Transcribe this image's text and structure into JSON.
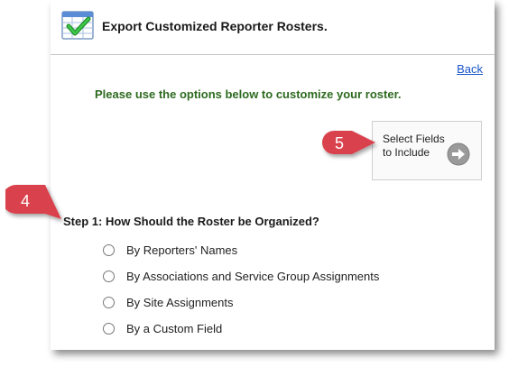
{
  "header": {
    "title": "Export Customized Reporter Rosters.",
    "icon": "checklist-icon"
  },
  "back_link": "Back",
  "instructions": "Please use the options below to customize your roster.",
  "select_fields_button": {
    "label": "Select Fields to Include",
    "icon": "arrow-right-circle-icon"
  },
  "step1": {
    "heading": "Step 1: How Should the Roster be Organized?",
    "options": [
      {
        "label": "By Reporters' Names",
        "selected": false
      },
      {
        "label": "By Associations and Service Group Assignments",
        "selected": false
      },
      {
        "label": "By Site Assignments",
        "selected": false
      },
      {
        "label": "By a Custom Field",
        "selected": false
      }
    ]
  },
  "callouts": [
    {
      "number": "5"
    },
    {
      "number": "4"
    }
  ],
  "colors": {
    "instruction_green": "#2d6a1f",
    "link_blue": "#1a55c7",
    "callout_red": "#d9424d"
  }
}
